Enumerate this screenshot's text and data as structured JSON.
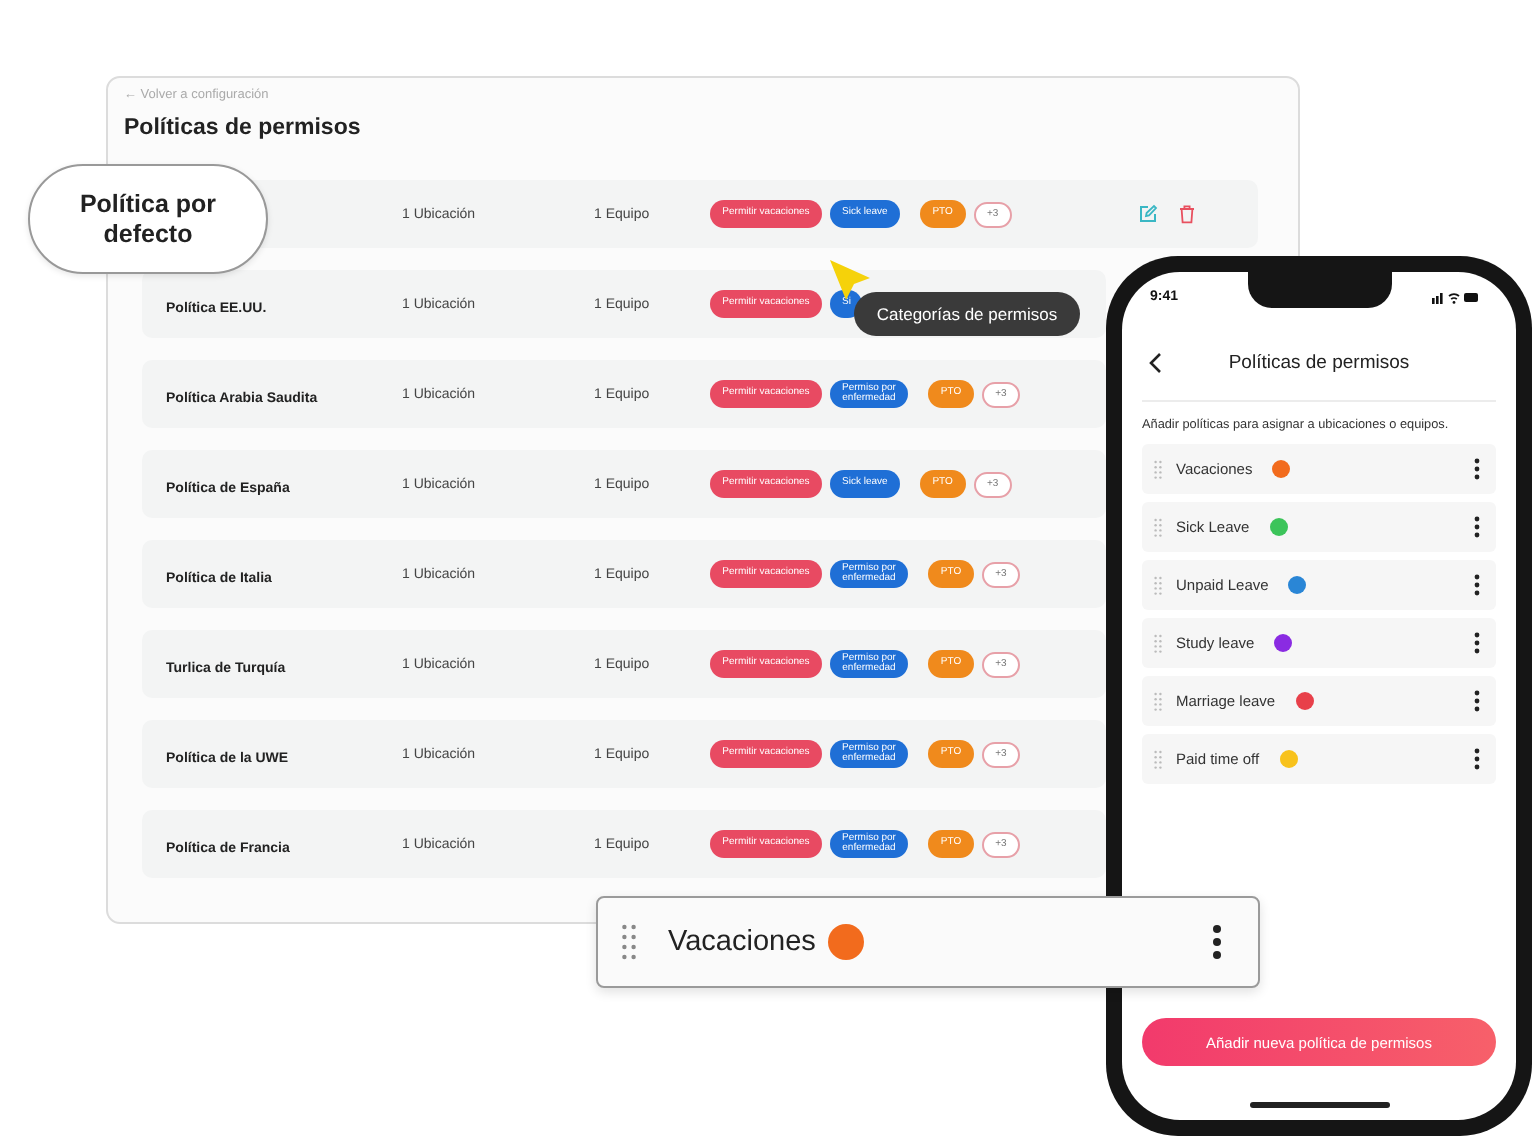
{
  "back_link": "← Volver a configuración",
  "title": "Políticas de permisos",
  "policies": [
    {
      "locations": "1 Ubicación",
      "teams": "1 Equipo",
      "tags": [
        {
          "label": "Permitir vacaciones",
          "color": "#e84a62"
        },
        {
          "label": "Sick leave",
          "color": "#1f6fd6"
        },
        {
          "label": "PTO",
          "color": "#f08a1c"
        }
      ],
      "more": "+3",
      "actions": [
        {
          "kind": "edit"
        },
        {
          "kind": "delete"
        }
      ]
    },
    {
      "name": "Política EE.UU.",
      "locations": "1 Ubicación",
      "teams": "1 Equipo",
      "tags": [
        {
          "label": "Permitir vacaciones",
          "color": "#e84a62"
        },
        {
          "label": "Si",
          "color": "#1f6fd6"
        }
      ]
    },
    {
      "name": "Política Arabia Saudita",
      "locations": "1 Ubicación",
      "teams": "1 Equipo",
      "tags": [
        {
          "label": "Permitir vacaciones",
          "color": "#e84a62"
        },
        {
          "label": "Permiso por enfermedad",
          "color": "#1f6fd6"
        },
        {
          "label": "PTO",
          "color": "#f08a1c"
        }
      ],
      "more": "+3"
    },
    {
      "name": "Política de España",
      "locations": "1 Ubicación",
      "teams": "1 Equipo",
      "tags": [
        {
          "label": "Permitir vacaciones",
          "color": "#e84a62"
        },
        {
          "label": "Sick leave",
          "color": "#1f6fd6"
        },
        {
          "label": "PTO",
          "color": "#f08a1c"
        }
      ],
      "more": "+3"
    },
    {
      "name": "Política de Italia",
      "locations": "1 Ubicación",
      "teams": "1 Equipo",
      "tags": [
        {
          "label": "Permitir vacaciones",
          "color": "#e84a62"
        },
        {
          "label": "Permiso por enfermedad",
          "color": "#1f6fd6"
        },
        {
          "label": "PTO",
          "color": "#f08a1c"
        }
      ],
      "more": "+3"
    },
    {
      "name": "Turlica de Turquía",
      "locations": "1 Ubicación",
      "teams": "1 Equipo",
      "tags": [
        {
          "label": "Permitir vacaciones",
          "color": "#e84a62"
        },
        {
          "label": "Permiso por enfermedad",
          "color": "#1f6fd6"
        },
        {
          "label": "PTO",
          "color": "#f08a1c"
        }
      ],
      "more": "+3"
    },
    {
      "name": "Política de la UWE",
      "locations": "1 Ubicación",
      "teams": "1 Equipo",
      "tags": [
        {
          "label": "Permitir vacaciones",
          "color": "#e84a62"
        },
        {
          "label": "Permiso por enfermedad",
          "color": "#1f6fd6"
        },
        {
          "label": "PTO",
          "color": "#f08a1c"
        }
      ],
      "more": "+3"
    },
    {
      "name": "Política de Francia",
      "locations": "1 Ubicación",
      "teams": "1 Equipo",
      "tags": [
        {
          "label": "Permitir vacaciones",
          "color": "#e84a62"
        },
        {
          "label": "Permiso por enfermedad",
          "color": "#1f6fd6"
        },
        {
          "label": "PTO",
          "color": "#f08a1c"
        }
      ],
      "more": "+3"
    }
  ],
  "callout": {
    "text": "Política por defecto"
  },
  "tooltip": {
    "text": "Categorías de permisos"
  },
  "phone": {
    "time": "9:41",
    "title": "Políticas de permisos",
    "subtitle": "Añadir políticas para asignar a ubicaciones o equipos.",
    "categories": [
      {
        "name": "Vacaciones",
        "color": "#f26b1d"
      },
      {
        "name": "Sick Leave",
        "color": "#3cc45a"
      },
      {
        "name": "Unpaid Leave",
        "color": "#2a86d6"
      },
      {
        "name": "Study leave",
        "color": "#8a2be2"
      },
      {
        "name": "Marriage leave",
        "color": "#e8404a"
      },
      {
        "name": "Paid time off",
        "color": "#f8c21c"
      }
    ],
    "add_button": "Añadir nueva política de permisos"
  },
  "drag_card": {
    "name": "Vacaciones",
    "color": "#f26b1d"
  }
}
